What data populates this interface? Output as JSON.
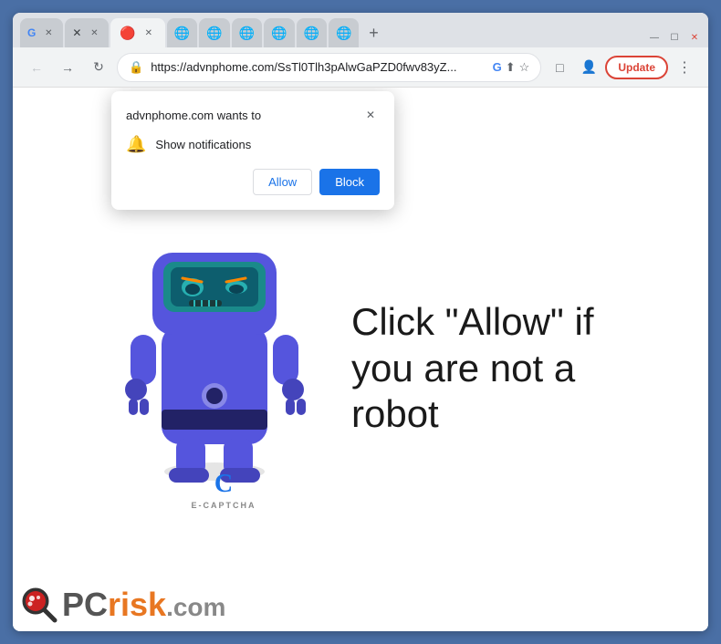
{
  "browser": {
    "tabs": [
      {
        "id": "tab1",
        "label": "",
        "active": false,
        "favicon": "×"
      },
      {
        "id": "tab2",
        "label": "",
        "active": false,
        "favicon": "🛡"
      },
      {
        "id": "tab3",
        "label": "",
        "active": true,
        "favicon": "🔴"
      },
      {
        "id": "tab4",
        "label": "",
        "active": false
      },
      {
        "id": "tab5",
        "label": "",
        "active": false
      },
      {
        "id": "tab6",
        "label": "",
        "active": false
      },
      {
        "id": "tab7",
        "label": "",
        "active": false
      },
      {
        "id": "tab8",
        "label": "",
        "active": false
      },
      {
        "id": "tab9",
        "label": "",
        "active": false
      }
    ],
    "window_controls": {
      "minimize": "—",
      "maximize": "☐",
      "close": "✕"
    },
    "address_bar": {
      "url": "https://advnphome.com/SsTl0Tlh3pAlwGaPZD0fwv83yZ...",
      "lock_icon": "🔒"
    },
    "update_button": "Update",
    "toolbar_icons": {
      "google": "G",
      "share": "⬆",
      "star": "☆",
      "extension": "□",
      "profile": "👤",
      "menu": "⋮"
    }
  },
  "notification_popup": {
    "title": "advnphome.com wants to",
    "close_icon": "✕",
    "notification_label": "Show notifications",
    "bell_icon": "🔔",
    "allow_button": "Allow",
    "block_button": "Block"
  },
  "page": {
    "click_text": "Click \"Allow\" if you are not a robot",
    "captcha_letter": "C",
    "captcha_label": "E-CAPTCHA"
  },
  "footer": {
    "pc_text": "PC",
    "risk_text": "risk",
    "com_text": ".com"
  },
  "colors": {
    "browser_border": "#4a6fa5",
    "allow_btn": "#1a73e8",
    "block_btn": "#1a73e8",
    "robot_body": "#4444cc",
    "update_btn": "#db4437"
  }
}
